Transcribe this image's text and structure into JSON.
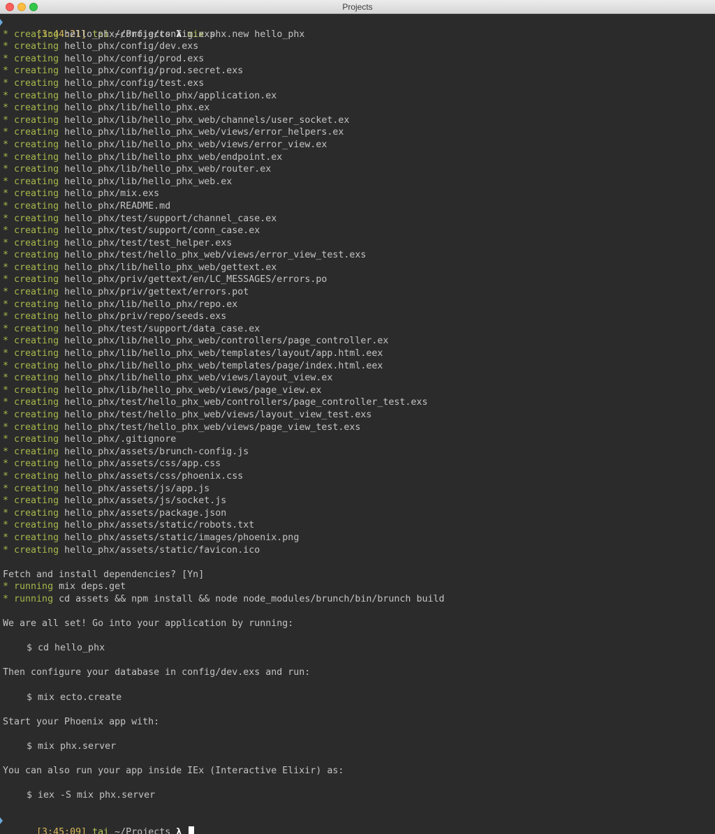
{
  "window": {
    "title": "Projects"
  },
  "prompt_first": {
    "time": "[3:44:21]",
    "user": "tai",
    "path": "~/Projects",
    "lambda": "λ",
    "command": "mix",
    "args": "phx.new hello_phx"
  },
  "created_files": [
    "hello_phx/config/config.exs",
    "hello_phx/config/dev.exs",
    "hello_phx/config/prod.exs",
    "hello_phx/config/prod.secret.exs",
    "hello_phx/config/test.exs",
    "hello_phx/lib/hello_phx/application.ex",
    "hello_phx/lib/hello_phx.ex",
    "hello_phx/lib/hello_phx_web/channels/user_socket.ex",
    "hello_phx/lib/hello_phx_web/views/error_helpers.ex",
    "hello_phx/lib/hello_phx_web/views/error_view.ex",
    "hello_phx/lib/hello_phx_web/endpoint.ex",
    "hello_phx/lib/hello_phx_web/router.ex",
    "hello_phx/lib/hello_phx_web.ex",
    "hello_phx/mix.exs",
    "hello_phx/README.md",
    "hello_phx/test/support/channel_case.ex",
    "hello_phx/test/support/conn_case.ex",
    "hello_phx/test/test_helper.exs",
    "hello_phx/test/hello_phx_web/views/error_view_test.exs",
    "hello_phx/lib/hello_phx_web/gettext.ex",
    "hello_phx/priv/gettext/en/LC_MESSAGES/errors.po",
    "hello_phx/priv/gettext/errors.pot",
    "hello_phx/lib/hello_phx/repo.ex",
    "hello_phx/priv/repo/seeds.exs",
    "hello_phx/test/support/data_case.ex",
    "hello_phx/lib/hello_phx_web/controllers/page_controller.ex",
    "hello_phx/lib/hello_phx_web/templates/layout/app.html.eex",
    "hello_phx/lib/hello_phx_web/templates/page/index.html.eex",
    "hello_phx/lib/hello_phx_web/views/layout_view.ex",
    "hello_phx/lib/hello_phx_web/views/page_view.ex",
    "hello_phx/test/hello_phx_web/controllers/page_controller_test.exs",
    "hello_phx/test/hello_phx_web/views/layout_view_test.exs",
    "hello_phx/test/hello_phx_web/views/page_view_test.exs",
    "hello_phx/.gitignore",
    "hello_phx/assets/brunch-config.js",
    "hello_phx/assets/css/app.css",
    "hello_phx/assets/css/phoenix.css",
    "hello_phx/assets/js/app.js",
    "hello_phx/assets/js/socket.js",
    "hello_phx/assets/package.json",
    "hello_phx/assets/static/robots.txt",
    "hello_phx/assets/static/images/phoenix.png",
    "hello_phx/assets/static/favicon.ico"
  ],
  "creating_verb": "creating",
  "bullet": "*",
  "fetch_question": "Fetch and install dependencies? [Yn]",
  "running_verb": "running",
  "running_cmds": [
    "mix deps.get",
    "cd assets && npm install && node node_modules/brunch/bin/brunch build"
  ],
  "instructions": {
    "all_set": "We are all set! Go into your application by running:",
    "cmd_cd": "$ cd hello_phx",
    "configure": "Then configure your database in config/dev.exs and run:",
    "cmd_ecto": "$ mix ecto.create",
    "start": "Start your Phoenix app with:",
    "cmd_server": "$ mix phx.server",
    "iex": "You can also run your app inside IEx (Interactive Elixir) as:",
    "cmd_iex": "$ iex -S mix phx.server"
  },
  "prompt_last": {
    "time": "[3:45:09]",
    "user": "tai",
    "path": "~/Projects",
    "lambda": "λ"
  }
}
